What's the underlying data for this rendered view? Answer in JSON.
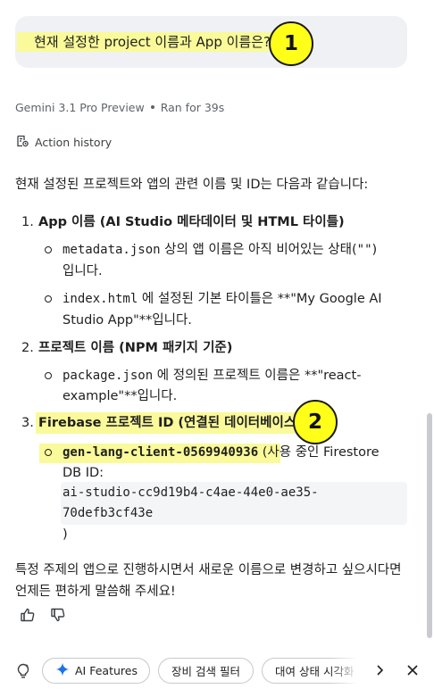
{
  "user_message": "현재 설정한 project 이름과 App 이름은?",
  "markers": {
    "first": "1",
    "second": "2"
  },
  "meta": {
    "model": "Gemini 3.1 Pro Preview",
    "runtime": "Ran for 39s"
  },
  "action_history_label": "Action history",
  "response": {
    "intro": "현재 설정된 프로젝트와 앱의 관련 이름 및 ID는 다음과 같습니다:",
    "sections": [
      {
        "number": "1.",
        "heading": "App 이름 (AI Studio 메타데이터 및 HTML 타이틀)",
        "items": [
          {
            "code": "metadata.json",
            "text": " 상의 앱 이름은 아직 비어있는 상태(",
            "code2": "\"\"",
            "text2": ")",
            "cont": "입니다."
          },
          {
            "code": "index.html",
            "text": " 에 설정된 기본 타이틀은 **\"My Google AI",
            "cont": "Studio App\"**입니다."
          }
        ]
      },
      {
        "number": "2.",
        "heading": "프로젝트 이름 (NPM 패키지 기준)",
        "items": [
          {
            "code": "package.json",
            "text": " 에 정의된 프로젝트 이름은 **\"react-",
            "cont": "example\"**입니다."
          }
        ]
      },
      {
        "number": "3.",
        "heading": "Firebase 프로젝트 ID (연결된 데이터베이스",
        "items": [
          {
            "code": "gen-lang-client-0569940936",
            "text": " (사용 중인 Firestore",
            "cont": "DB ID:",
            "code_lines": [
              "ai-studio-cc9d19b4-c4ae-44e0-ae35-",
              "70defb3cf43e"
            ],
            "close": ")"
          }
        ]
      }
    ],
    "closing": "특정 주제의 앱으로 진행하시면서 새로운 이름으로 변경하고 싶으시다면 언제든 편하게 말씀해 주세요!"
  },
  "bottom_bar": {
    "chips": [
      "AI Features",
      "장비 검색 필터",
      "대여 상태 시각화"
    ]
  },
  "icons": {
    "action_history": "history-icon",
    "thumbs_up": "thumbs-up-icon",
    "thumbs_down": "thumbs-down-icon",
    "suggestion": "lightbulb-icon",
    "sparkle": "sparkle-icon",
    "next": "chevron-right-icon",
    "close": "close-icon"
  },
  "colors": {
    "highlight": "#fafa9a",
    "marker": "#ffff1a",
    "sparkle": "#1a73e8",
    "bubble": "#f0f1f4"
  }
}
